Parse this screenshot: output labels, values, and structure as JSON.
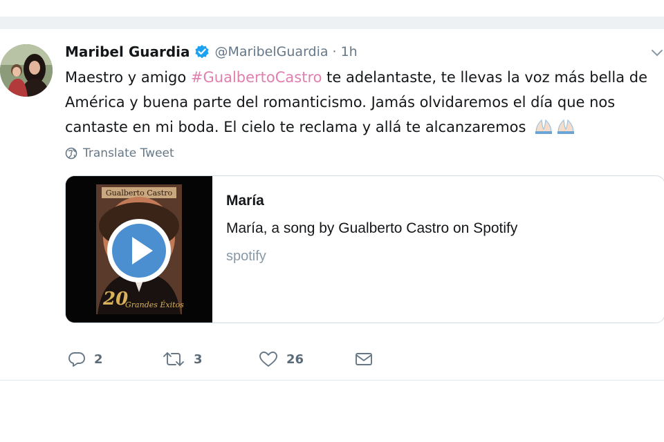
{
  "tweet": {
    "author_name": "Maribel Guardia",
    "handle": "@MaribelGuardia",
    "separator": "·",
    "time": "1h",
    "text_before": "Maestro y amigo ",
    "hashtag": "#GualbertoCastro",
    "text_after": " te adelantaste, te llevas la voz más bella de América y buena parte del romanticismo. Jamás olvidaremos el día que nos cantaste en mi boda. El cielo te reclama y allá te alcanzaremos",
    "translate_label": "Translate Tweet"
  },
  "card": {
    "title": "María",
    "description": "María, a song by Gualberto Castro on Spotify",
    "domain": "spotify",
    "cover_artist_text": "Gualberto Castro",
    "cover_number": "20",
    "cover_subtitle": "Grandes Éxitos"
  },
  "actions": {
    "reply_count": "2",
    "retweet_count": "3",
    "like_count": "26"
  },
  "colors": {
    "hashtag": "#e07fae",
    "verified": "#1da1f2",
    "secondary_text": "#657786",
    "play_button": "#4b8fd0"
  },
  "icons": {
    "verified": "verified-badge-icon",
    "caret": "chevron-down-icon",
    "translate": "globe-icon",
    "reply": "reply-icon",
    "retweet": "retweet-icon",
    "like": "heart-icon",
    "dm": "envelope-icon",
    "play": "play-icon",
    "emoji": "folded-hands-icon"
  }
}
